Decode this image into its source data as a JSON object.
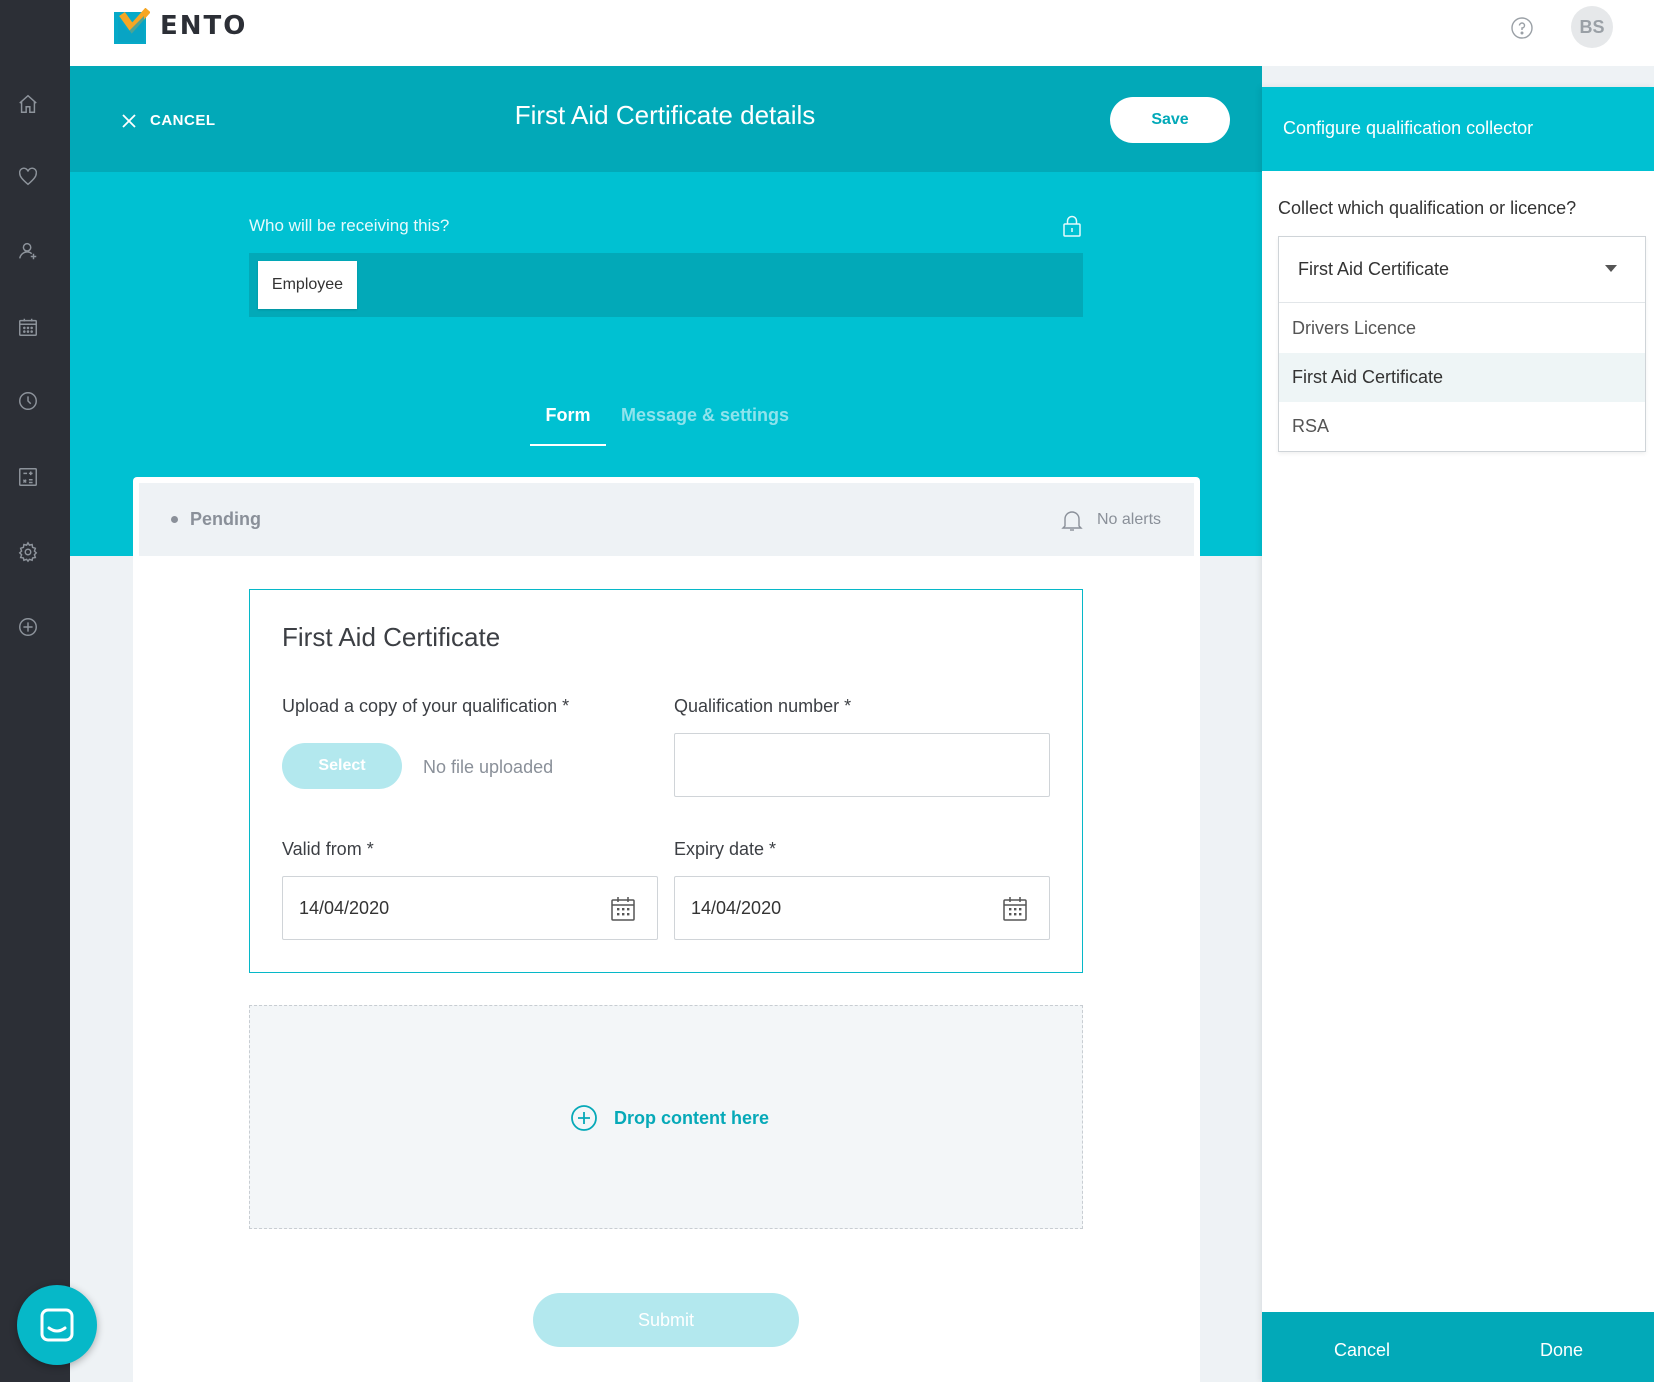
{
  "brand": {
    "name": "ENTO"
  },
  "user": {
    "initials": "BS"
  },
  "nav": {
    "icons": [
      "home-icon",
      "heart-icon",
      "user-add-icon",
      "calendar-icon",
      "clock-icon",
      "calculator-icon",
      "gear-icon",
      "plus-circle-icon"
    ]
  },
  "header": {
    "cancel_label": "CANCEL",
    "title": "First Aid Certificate details",
    "save_label": "Save"
  },
  "recipient": {
    "label": "Who will be receiving this?",
    "chip": "Employee"
  },
  "tabs": [
    {
      "label": "Form",
      "active": true
    },
    {
      "label": "Message & settings",
      "active": false
    }
  ],
  "status": {
    "state": "Pending",
    "alerts": "No alerts"
  },
  "qualification": {
    "title": "First Aid Certificate",
    "upload_label": "Upload a copy of your qualification *",
    "select_label": "Select",
    "no_file": "No file uploaded",
    "number_label": "Qualification number *",
    "number_value": "",
    "valid_from_label": "Valid from *",
    "valid_from_value": "14/04/2020",
    "expiry_label": "Expiry date *",
    "expiry_value": "14/04/2020"
  },
  "drop_zone": {
    "label": "Drop content here"
  },
  "submit_label": "Submit",
  "panel": {
    "title": "Configure qualification collector",
    "question": "Collect which qualification or licence?",
    "selected": "First Aid Certificate",
    "options": [
      "Drivers Licence",
      "First Aid Certificate",
      "RSA"
    ],
    "cancel_label": "Cancel",
    "done_label": "Done"
  },
  "colors": {
    "teal": "#00c1d2",
    "teal_dark": "#02a9b8",
    "nav_bg": "#2c2f36"
  }
}
